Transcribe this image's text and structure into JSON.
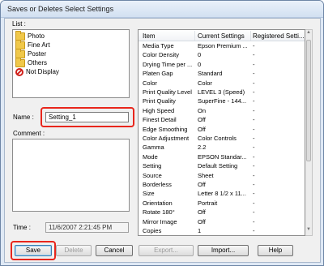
{
  "window": {
    "title": "Saves or Deletes Select Settings"
  },
  "list": {
    "label": "List :",
    "items": [
      {
        "label": "Photo",
        "icon": "folder-icon"
      },
      {
        "label": "Fine Art",
        "icon": "folder-icon"
      },
      {
        "label": "Poster",
        "icon": "folder-icon"
      },
      {
        "label": "Others",
        "icon": "folder-icon"
      },
      {
        "label": "Not Display",
        "icon": "no-display-icon"
      }
    ]
  },
  "name": {
    "label": "Name :",
    "value": "Setting_1"
  },
  "comment": {
    "label": "Comment :",
    "value": ""
  },
  "time": {
    "label": "Time :",
    "value": "11/6/2007 2:21:45 PM"
  },
  "settings_table": {
    "headers": [
      "Item",
      "Current Settings",
      "Registered Setti..."
    ],
    "rows": [
      [
        "Media Type",
        "Epson Premium ...",
        "-"
      ],
      [
        "Color Density",
        "0",
        "-"
      ],
      [
        "Drying Time per ...",
        "0",
        "-"
      ],
      [
        "Platen Gap",
        "Standard",
        "-"
      ],
      [
        "Color",
        "Color",
        "-"
      ],
      [
        "Print Quality Level",
        "LEVEL 3 (Speed)",
        "-"
      ],
      [
        "Print Quality",
        "SuperFine - 144...",
        "-"
      ],
      [
        "High Speed",
        "On",
        "-"
      ],
      [
        "Finest Detail",
        "Off",
        "-"
      ],
      [
        "Edge Smoothing",
        "Off",
        "-"
      ],
      [
        "Color Adjustment",
        "Color Controls",
        "-"
      ],
      [
        "Gamma",
        "2.2",
        "-"
      ],
      [
        "Mode",
        "EPSON Standar...",
        "-"
      ],
      [
        "Setting",
        "Default Setting",
        "-"
      ],
      [
        "Source",
        "Sheet",
        "-"
      ],
      [
        "Borderless",
        "Off",
        "-"
      ],
      [
        "Size",
        "Letter 8 1/2 x 11...",
        "-"
      ],
      [
        "Orientation",
        "Portrait",
        "-"
      ],
      [
        "Rotate 180°",
        "Off",
        "-"
      ],
      [
        "Mirror Image",
        "Off",
        "-"
      ],
      [
        "Copies",
        "1",
        "-"
      ]
    ]
  },
  "buttons": {
    "save": "Save",
    "delete": "Delete",
    "cancel": "Cancel",
    "export": "Export...",
    "import": "Import...",
    "help": "Help"
  },
  "colors": {
    "callout": "#e8261c",
    "accent": "#3c7fb1"
  }
}
